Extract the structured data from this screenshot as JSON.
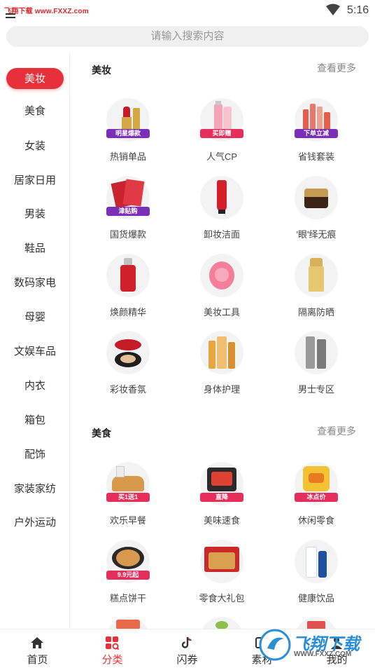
{
  "status_bar": {
    "watermark": "飞翔下载 www.FXXZ.com",
    "time": "5:16"
  },
  "search": {
    "placeholder": "请输入搜索内容"
  },
  "sidebar": {
    "items": [
      {
        "label": "美妆",
        "active": true
      },
      {
        "label": "美食"
      },
      {
        "label": "女装"
      },
      {
        "label": "居家日用"
      },
      {
        "label": "男装"
      },
      {
        "label": "鞋品"
      },
      {
        "label": "数码家电"
      },
      {
        "label": "母婴"
      },
      {
        "label": "文娱车品"
      },
      {
        "label": "内衣"
      },
      {
        "label": "箱包"
      },
      {
        "label": "配饰"
      },
      {
        "label": "家装家纺"
      },
      {
        "label": "户外运动"
      }
    ]
  },
  "sections": [
    {
      "title": "美妆",
      "more": "查看更多",
      "tiles": [
        {
          "label": "热销单品",
          "badge": "明星爆款",
          "badge_color": "#7b2fb8",
          "icon": "lipstick-icon"
        },
        {
          "label": "人气CP",
          "badge": "买即赠",
          "badge_color": "#e62e5c",
          "icon": "cosmetic-bottles-icon"
        },
        {
          "label": "省钱套装",
          "badge": "下单立减",
          "badge_color": "#7b2fb8",
          "icon": "skincare-set-icon"
        },
        {
          "label": "国货爆款",
          "badge": "津贴购",
          "badge_color": "#7b2fb8",
          "icon": "face-mask-icon"
        },
        {
          "label": "卸妆洁面",
          "icon": "cleanser-tube-icon"
        },
        {
          "label": "'眼'绎无痕",
          "icon": "eye-cream-jar-icon"
        },
        {
          "label": "焕颜精华",
          "icon": "serum-bottle-icon"
        },
        {
          "label": "美妆工具",
          "icon": "cleansing-brush-icon"
        },
        {
          "label": "隔离防晒",
          "icon": "sunscreen-bottle-icon"
        },
        {
          "label": "彩妆香氛",
          "icon": "cushion-compact-icon"
        },
        {
          "label": "身体护理",
          "icon": "body-oil-bottles-icon"
        },
        {
          "label": "男士专区",
          "icon": "men-skincare-icon"
        }
      ]
    },
    {
      "title": "美食",
      "more": "查看更多",
      "tiles": [
        {
          "label": "欢乐早餐",
          "badge": "买1送1",
          "badge_color": "#e62e5c",
          "icon": "bread-icon"
        },
        {
          "label": "美味速食",
          "badge": "直降",
          "badge_color": "#e62e5c",
          "icon": "instant-noodles-icon"
        },
        {
          "label": "休闲零食",
          "badge": "冰点价",
          "badge_color": "#e62e5c",
          "icon": "chips-bag-icon"
        },
        {
          "label": "糕点饼干",
          "badge": "9.9元起",
          "badge_color": "#e62e5c",
          "icon": "cookie-tin-icon"
        },
        {
          "label": "零食大礼包",
          "icon": "snack-gift-box-icon"
        },
        {
          "label": "健康饮品",
          "icon": "drink-bottle-icon"
        }
      ]
    }
  ],
  "tab_bar": {
    "tabs": [
      {
        "label": "首页",
        "icon": "home-icon"
      },
      {
        "label": "分类",
        "icon": "category-icon",
        "active": true
      },
      {
        "label": "闪券",
        "icon": "tiktok-icon"
      },
      {
        "label": "素材",
        "icon": "material-icon"
      },
      {
        "label": "我的",
        "icon": "profile-icon"
      }
    ]
  },
  "watermark": {
    "text": "飞翔下载",
    "url": "WWW.FXXZ.COM"
  },
  "colors": {
    "accent": "#e8303a",
    "search_bg": "#f0f0f0",
    "tile_bg": "#f3f3f3"
  }
}
